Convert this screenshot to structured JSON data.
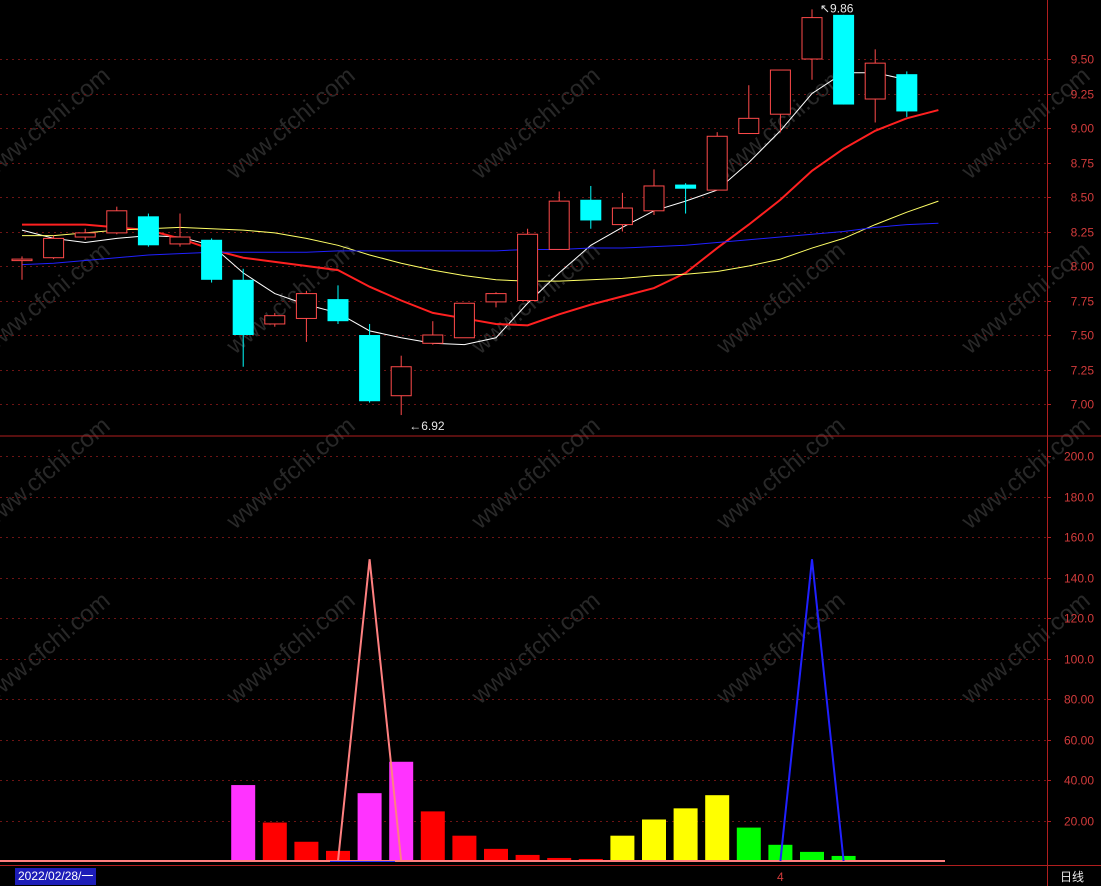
{
  "chart_data": [
    {
      "type": "candlestick",
      "title": "",
      "price_axis": {
        "ticks": [
          7.0,
          7.25,
          7.5,
          7.75,
          8.0,
          8.25,
          8.5,
          8.75,
          9.0,
          9.25,
          9.5
        ],
        "labels": [
          "7.00",
          "7.25",
          "7.50",
          "7.75",
          "8.00",
          "8.25",
          "8.50",
          "8.75",
          "9.00",
          "9.25",
          "9.50"
        ],
        "ylim": [
          6.75,
          10.0
        ]
      },
      "grid": true,
      "candles": [
        {
          "open": 8.05,
          "close": 8.05,
          "high": 8.07,
          "low": 7.9
        },
        {
          "open": 8.06,
          "close": 8.2,
          "high": 8.22,
          "low": 8.05
        },
        {
          "open": 8.21,
          "close": 8.24,
          "high": 8.27,
          "low": 8.19
        },
        {
          "open": 8.24,
          "close": 8.4,
          "high": 8.43,
          "low": 8.23
        },
        {
          "open": 8.36,
          "close": 8.15,
          "high": 8.38,
          "low": 8.14
        },
        {
          "open": 8.16,
          "close": 8.21,
          "high": 8.38,
          "low": 8.14
        },
        {
          "open": 8.19,
          "close": 7.9,
          "high": 8.2,
          "low": 7.88
        },
        {
          "open": 7.9,
          "close": 7.5,
          "high": 7.98,
          "low": 7.27
        },
        {
          "open": 7.58,
          "close": 7.64,
          "high": 7.66,
          "low": 7.56
        },
        {
          "open": 7.62,
          "close": 7.8,
          "high": 7.82,
          "low": 7.45
        },
        {
          "open": 7.76,
          "close": 7.6,
          "high": 7.86,
          "low": 7.58
        },
        {
          "open": 7.5,
          "close": 7.02,
          "high": 7.58,
          "low": 7.01
        },
        {
          "open": 7.06,
          "close": 7.27,
          "high": 7.35,
          "low": 6.92
        },
        {
          "open": 7.44,
          "close": 7.5,
          "high": 7.6,
          "low": 7.43
        },
        {
          "open": 7.48,
          "close": 7.73,
          "high": 7.73,
          "low": 7.48
        },
        {
          "open": 7.74,
          "close": 7.8,
          "high": 7.81,
          "low": 7.7
        },
        {
          "open": 7.75,
          "close": 8.23,
          "high": 8.27,
          "low": 7.74
        },
        {
          "open": 8.12,
          "close": 8.47,
          "high": 8.54,
          "low": 8.12
        },
        {
          "open": 8.48,
          "close": 8.33,
          "high": 8.58,
          "low": 8.27
        },
        {
          "open": 8.3,
          "close": 8.42,
          "high": 8.53,
          "low": 8.25
        },
        {
          "open": 8.4,
          "close": 8.58,
          "high": 8.7,
          "low": 8.37
        },
        {
          "open": 8.59,
          "close": 8.56,
          "high": 8.6,
          "low": 8.38
        },
        {
          "open": 8.55,
          "close": 8.94,
          "high": 8.97,
          "low": 8.55
        },
        {
          "open": 8.96,
          "close": 9.07,
          "high": 9.31,
          "low": 8.96
        },
        {
          "open": 9.1,
          "close": 9.42,
          "high": 9.42,
          "low": 8.97
        },
        {
          "open": 9.5,
          "close": 9.8,
          "high": 9.86,
          "low": 9.35
        },
        {
          "open": 9.82,
          "close": 9.17,
          "high": 9.82,
          "low": 9.17
        },
        {
          "open": 9.21,
          "close": 9.47,
          "high": 9.57,
          "low": 9.04
        },
        {
          "open": 9.39,
          "close": 9.12,
          "high": 9.41,
          "low": 9.08
        }
      ],
      "ma_series": [
        {
          "color": "#ffffff",
          "values": [
            8.26,
            8.2,
            8.17,
            8.2,
            8.22,
            8.21,
            8.15,
            7.95,
            7.8,
            7.72,
            7.66,
            7.53,
            7.48,
            7.44,
            7.43,
            7.48,
            7.73,
            7.95,
            8.15,
            8.28,
            8.4,
            8.47,
            8.55,
            8.75,
            8.98,
            9.25,
            9.4,
            9.4,
            9.35
          ]
        },
        {
          "color": "#ff2020",
          "values": [
            8.3,
            8.3,
            8.3,
            8.28,
            8.26,
            8.2,
            8.12,
            8.06,
            8.03,
            8.0,
            7.97,
            7.85,
            7.75,
            7.66,
            7.62,
            7.58,
            7.57,
            7.65,
            7.72,
            7.78,
            7.84,
            7.95,
            8.13,
            8.3,
            8.48,
            8.69,
            8.85,
            8.98,
            9.07,
            9.13
          ]
        },
        {
          "color": "#ffff66",
          "values": [
            8.22,
            8.22,
            8.24,
            8.26,
            8.27,
            8.28,
            8.27,
            8.26,
            8.24,
            8.2,
            8.15,
            8.08,
            8.02,
            7.97,
            7.93,
            7.9,
            7.89,
            7.89,
            7.9,
            7.91,
            7.93,
            7.94,
            7.96,
            8.0,
            8.05,
            8.13,
            8.2,
            8.3,
            8.39,
            8.47
          ]
        },
        {
          "color": "#2020ff",
          "values": [
            8.01,
            8.02,
            8.04,
            8.06,
            8.08,
            8.09,
            8.1,
            8.1,
            8.1,
            8.1,
            8.11,
            8.11,
            8.11,
            8.11,
            8.11,
            8.11,
            8.12,
            8.12,
            8.13,
            8.13,
            8.14,
            8.15,
            8.17,
            8.19,
            8.21,
            8.23,
            8.25,
            8.28,
            8.3,
            8.31
          ]
        }
      ],
      "annotations": [
        {
          "text": "←6.92",
          "candle": 12,
          "value": 6.92
        },
        {
          "text": "↖9.86",
          "candle": 25,
          "value": 9.86
        }
      ]
    },
    {
      "type": "bar",
      "title": "",
      "value_axis": {
        "ticks": [
          20,
          40,
          60,
          80,
          100,
          120,
          140,
          160,
          180,
          200
        ],
        "labels": [
          "20.00",
          "40.00",
          "60.00",
          "80.00",
          "100.0",
          "120.0",
          "140.0",
          "160.0",
          "180.0",
          "200.0"
        ],
        "ylim": [
          0,
          208
        ]
      },
      "grid": true,
      "bars": [
        {
          "value": 37.5,
          "color": "#ff33ff"
        },
        {
          "value": 19.0,
          "color": "#ff0000"
        },
        {
          "value": 9.5,
          "color": "#ff0000"
        },
        {
          "value": 5.0,
          "color": "#ff0000"
        },
        {
          "value": 33.5,
          "color": "#ff33ff"
        },
        {
          "value": 49.0,
          "color": "#ff33ff"
        },
        {
          "value": 24.5,
          "color": "#ff0000"
        },
        {
          "value": 12.5,
          "color": "#ff0000"
        },
        {
          "value": 6.0,
          "color": "#ff0000"
        },
        {
          "value": 3.0,
          "color": "#ff0000"
        },
        {
          "value": 1.5,
          "color": "#ff0000"
        },
        {
          "value": 1.0,
          "color": "#ff0000"
        },
        {
          "value": 12.5,
          "color": "#ffff00"
        },
        {
          "value": 20.5,
          "color": "#ffff00"
        },
        {
          "value": 26.0,
          "color": "#ffff00"
        },
        {
          "value": 32.5,
          "color": "#ffff00"
        },
        {
          "value": 16.5,
          "color": "#00ff00"
        },
        {
          "value": 8.0,
          "color": "#00ff00"
        },
        {
          "value": 4.5,
          "color": "#00ff00"
        },
        {
          "value": 2.5,
          "color": "#00ff00"
        }
      ],
      "spike_lines": [
        {
          "color": "#ff8080",
          "points": [
            [
              10,
              0
            ],
            [
              11,
              149
            ],
            [
              12,
              0
            ]
          ]
        },
        {
          "color": "#2020ff",
          "points": [
            [
              24,
              0
            ],
            [
              25,
              149
            ],
            [
              26,
              0
            ]
          ]
        }
      ]
    }
  ],
  "footer": {
    "date": "2022/02/28/一",
    "month_marker": "4",
    "period": "日线"
  },
  "watermark": "www.cfchi.com"
}
